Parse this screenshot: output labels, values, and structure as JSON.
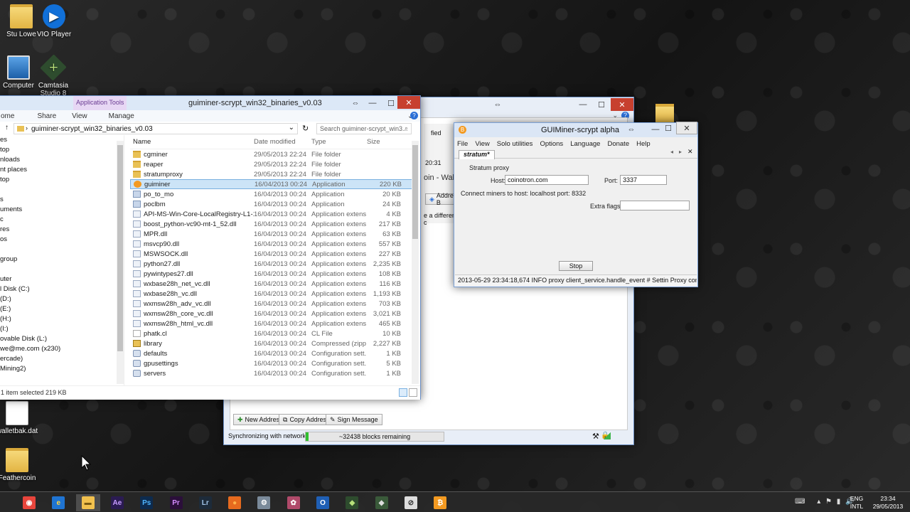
{
  "desktop": {
    "icons": [
      {
        "label": "Stu Lowe"
      },
      {
        "label": "VIO Player"
      },
      {
        "label": "Computer"
      },
      {
        "label": "Camtasia Studio 8"
      },
      {
        "label": "walletbak.dat"
      },
      {
        "label": "Feathercoin"
      }
    ]
  },
  "explorer": {
    "title": "guiminer-scrypt_win32_binaries_v0.03",
    "context_tab": "Application Tools",
    "ribbon": [
      "ome",
      "Share",
      "View",
      "Manage"
    ],
    "address": "guiminer-scrypt_win32_binaries_v0.03",
    "search_placeholder": "Search guiminer-scrypt_win3...",
    "nav": [
      "es",
      "top",
      "nloads",
      "nt places",
      "top",
      "",
      "s",
      "uments",
      "c",
      "res",
      "os",
      "",
      "group",
      "",
      "uter",
      "l Disk (C:)",
      "(D:)",
      "(E:)",
      "(H:)",
      "(I:)",
      "ovable Disk (L:)",
      "we@me.com (x230)",
      "ercade)",
      "Mining2)"
    ],
    "columns": {
      "name": "Name",
      "date": "Date modified",
      "type": "Type",
      "size": "Size"
    },
    "files": [
      {
        "name": "cgminer",
        "date": "29/05/2013 22:24",
        "type": "File folder",
        "size": "",
        "icon": "folder"
      },
      {
        "name": "reaper",
        "date": "29/05/2013 22:24",
        "type": "File folder",
        "size": "",
        "icon": "folder"
      },
      {
        "name": "stratumproxy",
        "date": "29/05/2013 22:24",
        "type": "File folder",
        "size": "",
        "icon": "folder"
      },
      {
        "name": "guiminer",
        "date": "16/04/2013 00:24",
        "type": "Application",
        "size": "220 KB",
        "icon": "app"
      },
      {
        "name": "po_to_mo",
        "date": "16/04/2013 00:24",
        "type": "Application",
        "size": "20 KB",
        "icon": "app2"
      },
      {
        "name": "poclbm",
        "date": "16/04/2013 00:24",
        "type": "Application",
        "size": "24 KB",
        "icon": "app2"
      },
      {
        "name": "API-MS-Win-Core-LocalRegistry-L1-1-0.dll",
        "date": "16/04/2013 00:24",
        "type": "Application extens...",
        "size": "4 KB",
        "icon": "dll"
      },
      {
        "name": "boost_python-vc90-mt-1_52.dll",
        "date": "16/04/2013 00:24",
        "type": "Application extens...",
        "size": "217 KB",
        "icon": "dll"
      },
      {
        "name": "MPR.dll",
        "date": "16/04/2013 00:24",
        "type": "Application extens...",
        "size": "63 KB",
        "icon": "dll"
      },
      {
        "name": "msvcp90.dll",
        "date": "16/04/2013 00:24",
        "type": "Application extens...",
        "size": "557 KB",
        "icon": "dll"
      },
      {
        "name": "MSWSOCK.dll",
        "date": "16/04/2013 00:24",
        "type": "Application extens...",
        "size": "227 KB",
        "icon": "dll"
      },
      {
        "name": "python27.dll",
        "date": "16/04/2013 00:24",
        "type": "Application extens...",
        "size": "2,235 KB",
        "icon": "dll"
      },
      {
        "name": "pywintypes27.dll",
        "date": "16/04/2013 00:24",
        "type": "Application extens...",
        "size": "108 KB",
        "icon": "dll"
      },
      {
        "name": "wxbase28h_net_vc.dll",
        "date": "16/04/2013 00:24",
        "type": "Application extens...",
        "size": "116 KB",
        "icon": "dll"
      },
      {
        "name": "wxbase28h_vc.dll",
        "date": "16/04/2013 00:24",
        "type": "Application extens...",
        "size": "1,193 KB",
        "icon": "dll"
      },
      {
        "name": "wxmsw28h_adv_vc.dll",
        "date": "16/04/2013 00:24",
        "type": "Application extens...",
        "size": "703 KB",
        "icon": "dll"
      },
      {
        "name": "wxmsw28h_core_vc.dll",
        "date": "16/04/2013 00:24",
        "type": "Application extens...",
        "size": "3,021 KB",
        "icon": "dll"
      },
      {
        "name": "wxmsw28h_html_vc.dll",
        "date": "16/04/2013 00:24",
        "type": "Application extens...",
        "size": "465 KB",
        "icon": "dll"
      },
      {
        "name": "phatk.cl",
        "date": "16/04/2013 00:24",
        "type": "CL File",
        "size": "10 KB",
        "icon": "cl"
      },
      {
        "name": "library",
        "date": "16/04/2013 00:24",
        "type": "Compressed (zipp...",
        "size": "2,227 KB",
        "icon": "zip"
      },
      {
        "name": "defaults",
        "date": "16/04/2013 00:24",
        "type": "Configuration sett...",
        "size": "1 KB",
        "icon": "cfg"
      },
      {
        "name": "gpusettings",
        "date": "16/04/2013 00:24",
        "type": "Configuration sett...",
        "size": "5 KB",
        "icon": "cfg"
      },
      {
        "name": "servers",
        "date": "16/04/2013 00:24",
        "type": "Configuration sett...",
        "size": "1 KB",
        "icon": "cfg"
      }
    ],
    "selected_index": 3,
    "status": "1 item selected  219 KB"
  },
  "wallet": {
    "partial_time": "20:31",
    "partial_title": "oin - Wall",
    "partial_ified": "fied",
    "partial_addr_btn": "Address B",
    "partial_diff": "e a different c",
    "buttons": {
      "new_address": "New Address",
      "copy_address": "Copy Address",
      "sign_message": "Sign Message"
    },
    "sync_label": "Synchronizing with network...",
    "blocks_remaining": "~32438 blocks remaining",
    "progress_fraction": 0.02
  },
  "guiminer": {
    "title": "GUIMiner-scrypt alpha",
    "menu": [
      "File",
      "View",
      "Solo utilities",
      "Options",
      "Language",
      "Donate",
      "Help"
    ],
    "tab": "stratum*",
    "section": "Stratum proxy",
    "host_label": "Host:",
    "host_value": "coinotron.com",
    "port_label": "Port:",
    "port_value": "3337",
    "connect_text": "Connect miners to  host: localhost port: 8332",
    "extra_flags_label": "Extra flags:",
    "extra_flags_value": "",
    "stop_label": "Stop",
    "status": "2013-05-29 23:34:18,674 INFO proxy client_service.handle_event # Settin Proxy connected"
  },
  "taskbar": {
    "apps": [
      "chrome",
      "ie",
      "explorer",
      "Ae",
      "Ps",
      "Pr",
      "Lr",
      "firefox",
      "app",
      "app2",
      "outlook",
      "camtasia",
      "app3",
      "safari",
      "bitcoin"
    ],
    "lang_top": "ENG",
    "lang_bottom": "INTL",
    "time": "23:34",
    "date": "29/05/2013"
  },
  "colors": {
    "close_red": "#c7402f",
    "selection": "#cce4f7",
    "progress_green": "#30c030",
    "bitcoin_orange": "#f39a21"
  }
}
